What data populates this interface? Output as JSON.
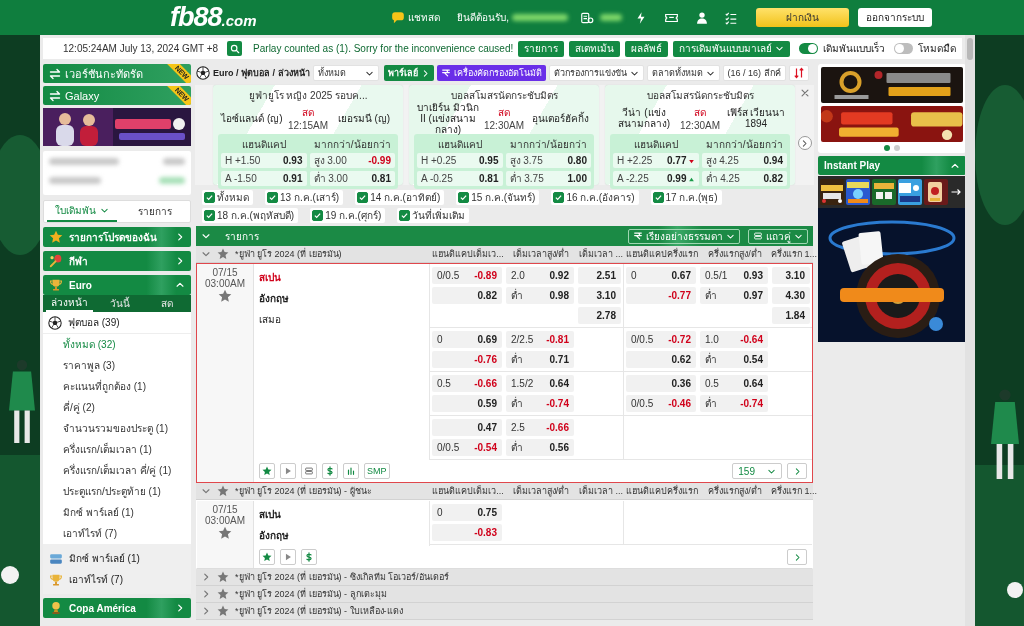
{
  "header": {
    "logo": "fb88",
    "logo_domain": ".com",
    "chat": "แชทสด",
    "welcome": "ยินดีต้อนรับ,",
    "deposit": "ฝากเงิน",
    "logout": "ออกจากระบบ"
  },
  "topbar": {
    "clock": "12:05:24AM July 13, 2024 GMT +8",
    "notice": "Parlay counted as (1). Sorry for the inconvenience caused!",
    "buttons": [
      "รายการ",
      "สเตทเม้น",
      "ผลลัพธ์"
    ],
    "odds_type": "การเดิมพันแบบมาเลย์",
    "toggles": [
      {
        "label": "เดิมพันแบบเร็ว",
        "on": true
      },
      {
        "label": "โหมดมืด",
        "on": false
      }
    ]
  },
  "sidebar": {
    "switches": [
      {
        "label": "เวอร์ชันกะทัดรัด",
        "badge": "NEW"
      },
      {
        "label": "Galaxy",
        "badge": "NEW"
      }
    ],
    "tabs": [
      {
        "label": "ใบเดิมพัน",
        "selected": true
      },
      {
        "label": "รายการ",
        "selected": false
      }
    ],
    "sections": [
      {
        "title": "รายการโปรดของฉัน",
        "kind": "star",
        "expanded": false
      },
      {
        "title": "กีฬา",
        "kind": "sports",
        "expanded": false
      },
      {
        "title": "Euro",
        "kind": "trophy",
        "expanded": true,
        "tabs": [
          {
            "label": "ล่วงหน้า",
            "selected": true
          },
          {
            "label": "วันนี้",
            "selected": false
          },
          {
            "label": "สด",
            "selected": false
          }
        ],
        "sport": "ฟุตบอล (39)",
        "items": [
          {
            "label": "ทั้งหมด (32)",
            "selected": true
          },
          {
            "label": "ราคาพูล (3)",
            "selected": false
          },
          {
            "label": "คะแนนที่ถูกต้อง (1)",
            "selected": false
          },
          {
            "label": "คี่/คู่ (2)",
            "selected": false
          },
          {
            "label": "จำนวนรวมของประตู (1)",
            "selected": false
          },
          {
            "label": "ครึ่งแรก/เต็มเวลา (1)",
            "selected": false
          },
          {
            "label": "ครึ่งแรก/เต็มเวลา คี่/คู่ (1)",
            "selected": false
          },
          {
            "label": "ประตูแรก/ประตูท้าย (1)",
            "selected": false
          },
          {
            "label": "มิกซ์ พาร์เลย์ (1)",
            "selected": false
          },
          {
            "label": "เอาท์ไรท์ (7)",
            "selected": false
          }
        ],
        "extras": [
          {
            "label": "มิกซ์ พาร์เลย์ (1)",
            "kind": "parlay"
          },
          {
            "label": "เอาท์ไรท์ (7)",
            "kind": "trophy"
          }
        ]
      },
      {
        "title": "Copa América",
        "kind": "cup",
        "expanded": false
      }
    ]
  },
  "toolbar": {
    "breadcrumb": "Euro / ฟุตบอล / ล่วงหน้า",
    "period": "ทั้งหมด",
    "parlay": "พาร์เลย์",
    "auto_filter": "เครื่องคัดกรองอัตโนมัติ",
    "match_filter": "ตัวกรองการแข่งขัน",
    "market_filter": "ตลาดทั้งหมด",
    "league_count": "(16 / 16) ลีกค์"
  },
  "featured": [
    {
      "league": "ยูฟ่ายูโร หญิง 2025 รอบค...",
      "home": "ไอซ์แลนด์ (ญ)",
      "status": "สด",
      "time": "12:15AM",
      "away": "เยอรมนี (ญ)",
      "hdp_title": "แฮนดิแคป",
      "ou_title": "มากกว่า/น้อยกว่า",
      "hdp": [
        {
          "label": "H +1.50",
          "odds": "0.93",
          "neg": false
        },
        {
          "label": "A -1.50",
          "odds": "0.91",
          "neg": false
        }
      ],
      "ou": [
        {
          "label": "สูง 3.00",
          "odds": "-0.99",
          "neg": true
        },
        {
          "label": "ต่ำ 3.00",
          "odds": "0.81",
          "neg": false
        }
      ]
    },
    {
      "league": "บอลสโมสรนัดกระชับมิตร",
      "home": "บาเยิร์น มิวนิก II (แข่งสนามกลาง)",
      "status": "สด",
      "time": "12:30AM",
      "away": "อุนเตอร์ฮัคกิ้ง",
      "hdp_title": "แฮนดิแคป",
      "ou_title": "มากกว่า/น้อยกว่า",
      "hdp": [
        {
          "label": "H +0.25",
          "odds": "0.95",
          "neg": false
        },
        {
          "label": "A -0.25",
          "odds": "0.81",
          "neg": false
        }
      ],
      "ou": [
        {
          "label": "สูง 3.75",
          "odds": "0.80",
          "neg": false
        },
        {
          "label": "ต่ำ 3.75",
          "odds": "1.00",
          "neg": false
        }
      ]
    },
    {
      "league": "บอลสโมสรนัดกระชับมิตร",
      "home": "วีน่า (แข่งสนามกลาง)",
      "status": "สด",
      "time": "12:30AM",
      "away": "เฟิร์ส เวียนนา 1894",
      "hdp_title": "แฮนดิแคป",
      "ou_title": "มากกว่า/น้อยกว่า",
      "hdp": [
        {
          "label": "H +2.25",
          "odds": "0.77",
          "neg": false,
          "falling": true,
          "rising": false
        },
        {
          "label": "A -2.25",
          "odds": "0.99",
          "neg": false,
          "falling": false,
          "rising": true
        }
      ],
      "ou": [
        {
          "label": "สูง 4.25",
          "odds": "0.94",
          "neg": false
        },
        {
          "label": "ต่ำ 4.25",
          "odds": "0.82",
          "neg": false
        }
      ]
    }
  ],
  "date_filters": [
    {
      "label": "ทั้งหมด",
      "checked": true
    },
    {
      "label": "13 ก.ค.(เสาร์)",
      "checked": true
    },
    {
      "label": "14 ก.ค.(อาทิตย์)",
      "checked": true
    },
    {
      "label": "15 ก.ค.(จันทร์)",
      "checked": true
    },
    {
      "label": "16 ก.ค.(อังคาร)",
      "checked": true
    },
    {
      "label": "17 ก.ค.(พุธ)",
      "checked": true
    },
    {
      "label": "18 ก.ค.(พฤหัสบดี)",
      "checked": true
    },
    {
      "label": "19 ก.ค.(ศุกร์)",
      "checked": true
    },
    {
      "label": "วันที่เพิ่มเติม",
      "checked": true
    }
  ],
  "odds_table": {
    "title": "รายการ",
    "sort": "เรียงอย่างธรรมดา",
    "view": "แถวคู่",
    "leagues": [
      {
        "name": "*ยูฟ่า ยูโร 2024 (ที่ เยอรมัน)",
        "expanded": true,
        "columns": [
          "แฮนดิแคปเต็มเว...",
          "เต็มเวลาสูง/ต่ำ",
          "เต็มเวลา ...",
          "แฮนดิแคปครึ่งแรก",
          "ครึ่งแรกสูง/ต่ำ",
          "ครึ่งแรก 1..."
        ],
        "matches": [
          {
            "date": "07/15",
            "time": "03:00AM",
            "highlighted": true,
            "teams": [
              {
                "name": "สเปน",
                "kind": "team",
                "favored": true
              },
              {
                "name": "อังกฤษ",
                "kind": "team",
                "favored": false
              },
              {
                "name": "เสมอ",
                "kind": "draw",
                "favored": false
              }
            ],
            "lines": [
              {
                "ft_hdp": [
                  {
                    "line": "0/0.5",
                    "odds": "-0.89",
                    "neg": true
                  },
                  {
                    "odds": "0.82",
                    "neg": false
                  }
                ],
                "ft_ou": [
                  {
                    "line": "2.0",
                    "odds": "0.92",
                    "neg": false
                  },
                  {
                    "line": "ต่ำ",
                    "odds": "0.98",
                    "neg": false
                  }
                ],
                "ft_1x2": [
                  {
                    "odds": "2.51",
                    "neg": false
                  },
                  {
                    "odds": "3.10",
                    "neg": false
                  },
                  {
                    "odds": "2.78",
                    "neg": false
                  }
                ],
                "ht_hdp": [
                  {
                    "line": "0",
                    "odds": "0.67",
                    "neg": false
                  },
                  {
                    "odds": "-0.77",
                    "neg": true
                  }
                ],
                "ht_ou": [
                  {
                    "line": "0.5/1",
                    "odds": "0.93",
                    "neg": false
                  },
                  {
                    "line": "ต่ำ",
                    "odds": "0.97",
                    "neg": false
                  }
                ],
                "ht_1x2": [
                  {
                    "odds": "3.10",
                    "neg": false
                  },
                  {
                    "odds": "4.30",
                    "neg": false
                  },
                  {
                    "odds": "1.84",
                    "neg": false
                  }
                ]
              },
              {
                "ft_hdp": [
                  {
                    "line": "0",
                    "odds": "0.69",
                    "neg": false
                  },
                  {
                    "odds": "-0.76",
                    "neg": true
                  }
                ],
                "ft_ou": [
                  {
                    "line": "2/2.5",
                    "odds": "-0.81",
                    "neg": true
                  },
                  {
                    "line": "ต่ำ",
                    "odds": "0.71",
                    "neg": false
                  }
                ],
                "ht_hdp": [
                  {
                    "line": "0/0.5",
                    "odds": "-0.72",
                    "neg": true
                  },
                  {
                    "odds": "0.62",
                    "neg": false
                  }
                ],
                "ht_ou": [
                  {
                    "line": "1.0",
                    "odds": "-0.64",
                    "neg": true
                  },
                  {
                    "line": "ต่ำ",
                    "odds": "0.54",
                    "neg": false
                  }
                ]
              },
              {
                "ft_hdp": [
                  {
                    "line": "0.5",
                    "odds": "-0.66",
                    "neg": true
                  },
                  {
                    "odds": "0.59",
                    "neg": false
                  }
                ],
                "ft_ou": [
                  {
                    "line": "1.5/2",
                    "odds": "0.64",
                    "neg": false
                  },
                  {
                    "line": "ต่ำ",
                    "odds": "-0.74",
                    "neg": true
                  }
                ],
                "ht_hdp": [
                  {
                    "odds": "0.36",
                    "neg": false
                  },
                  {
                    "line": "0/0.5",
                    "odds": "-0.46",
                    "neg": true
                  }
                ],
                "ht_ou": [
                  {
                    "line": "0.5",
                    "odds": "0.64",
                    "neg": false
                  },
                  {
                    "line": "ต่ำ",
                    "odds": "-0.74",
                    "neg": true
                  }
                ]
              },
              {
                "ft_hdp": [
                  {
                    "odds": "0.47",
                    "neg": false
                  },
                  {
                    "line": "0/0.5",
                    "odds": "-0.54",
                    "neg": true
                  }
                ],
                "ft_ou": [
                  {
                    "line": "2.5",
                    "odds": "-0.66",
                    "neg": true
                  },
                  {
                    "line": "ต่ำ",
                    "odds": "0.56",
                    "neg": false
                  }
                ]
              }
            ],
            "tools": [
              {
                "kind": "star"
              },
              {
                "kind": "play"
              },
              {
                "kind": "list"
              },
              {
                "kind": "dollar"
              },
              {
                "kind": "stats"
              },
              {
                "kind": "text",
                "label": "SMP"
              }
            ],
            "more_count": "159"
          }
        ]
      },
      {
        "name": "*ยูฟ่า ยูโร 2024 (ที่ เยอรมัน) - ผู้ชนะ",
        "expanded": true,
        "columns": [
          "แฮนดิแคปเต็มเว...",
          "เต็มเวลาสูง/ต่ำ",
          "เต็มเวลา ...",
          "แฮนดิแคปครึ่งแรก",
          "ครึ่งแรกสูง/ต่ำ",
          "ครึ่งแรก 1..."
        ],
        "matches": [
          {
            "date": "07/15",
            "time": "03:00AM",
            "highlighted": false,
            "teams": [
              {
                "name": "สเปน",
                "kind": "team",
                "favored": false
              },
              {
                "name": "อังกฤษ",
                "kind": "team",
                "favored": false
              }
            ],
            "lines": [
              {
                "ft_hdp": [
                  {
                    "line": "0",
                    "odds": "0.75",
                    "neg": false
                  },
                  {
                    "odds": "-0.83",
                    "neg": true
                  }
                ]
              }
            ],
            "tools": [
              {
                "kind": "star"
              },
              {
                "kind": "play"
              },
              {
                "kind": "dollar"
              }
            ]
          }
        ]
      },
      {
        "name": "*ยูฟ่า ยูโร 2024 (ที่ เยอรมัน) - ซิงเกิลทีม โอเวอร์/อันเดอร์",
        "expanded": false
      },
      {
        "name": "*ยูฟ่า ยูโร 2024 (ที่ เยอรมัน) - ลูกเตะมุม",
        "expanded": false
      },
      {
        "name": "*ยูฟ่า ยูโร 2024 (ที่ เยอรมัน) - ใบเหลือง-แดง",
        "expanded": false
      }
    ]
  },
  "right_panel": {
    "carousel": [
      {
        "selected": true
      },
      {
        "selected": false
      }
    ],
    "instant_play": {
      "title": "Instant Play",
      "expanded": true
    }
  }
}
